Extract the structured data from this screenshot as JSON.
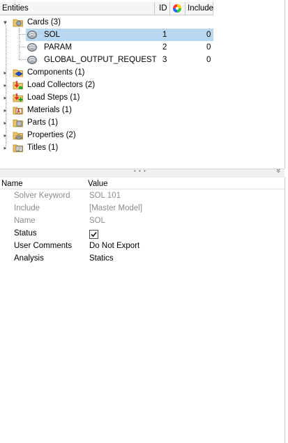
{
  "tree_header": {
    "entities": "Entities",
    "id": "ID",
    "include": "Include"
  },
  "tree": [
    {
      "label": "Cards (3)",
      "icon": "cards-folder-icon"
    },
    {
      "label": "SOL",
      "id": "1",
      "include": "0",
      "icon": "card-icon",
      "selected": true
    },
    {
      "label": "PARAM",
      "id": "2",
      "include": "0",
      "icon": "card-icon"
    },
    {
      "label": "GLOBAL_OUTPUT_REQUEST",
      "id": "3",
      "include": "0",
      "icon": "card-icon"
    },
    {
      "label": "Components (1)",
      "icon": "component-icon"
    },
    {
      "label": "Load Collectors (2)",
      "icon": "load-collector-icon"
    },
    {
      "label": "Load Steps (1)",
      "icon": "load-step-icon"
    },
    {
      "label": "Materials (1)",
      "icon": "material-icon"
    },
    {
      "label": "Parts (1)",
      "icon": "part-icon"
    },
    {
      "label": "Properties (2)",
      "icon": "property-icon"
    },
    {
      "label": "Titles (1)",
      "icon": "title-icon"
    }
  ],
  "splitter": {
    "grip": "• • •",
    "collapse": "»"
  },
  "props_header": {
    "name": "Name",
    "value": "Value"
  },
  "props": [
    {
      "name": "Solver Keyword",
      "value": "SOL 101",
      "dim": true
    },
    {
      "name": "Include",
      "value": "[Master Model]",
      "dim": true
    },
    {
      "name": "Name",
      "value": "SOL",
      "dim": true
    },
    {
      "name": "Status",
      "checked": true
    },
    {
      "name": "User Comments",
      "value": "Do Not Export"
    },
    {
      "name": "Analysis",
      "value": "Statics"
    }
  ],
  "colors": {
    "selection": "#b9d7ee",
    "dim_text": "#8c8c8c"
  }
}
